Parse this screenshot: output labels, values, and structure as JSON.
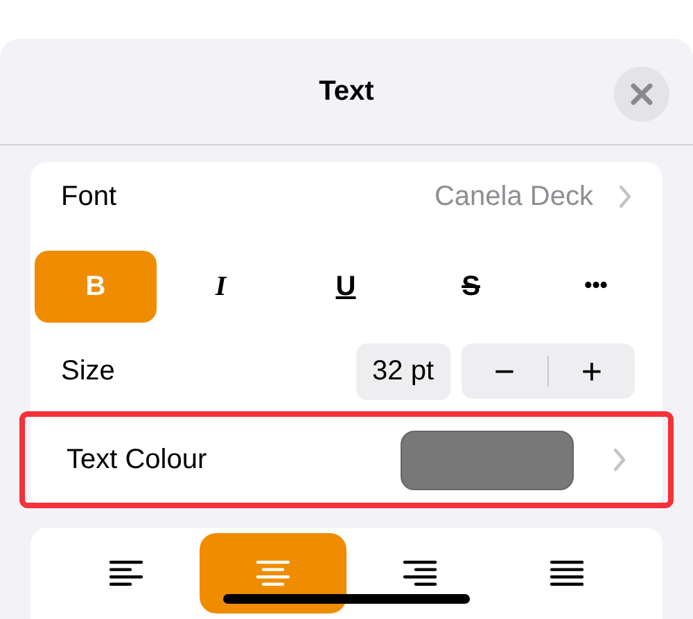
{
  "sheet": {
    "title": "Text"
  },
  "font": {
    "label": "Font",
    "value": "Canela Deck"
  },
  "styles": [
    {
      "label": "B",
      "kind": "bold",
      "selected": true
    },
    {
      "label": "I",
      "kind": "italic",
      "selected": false
    },
    {
      "label": "U",
      "kind": "underline",
      "selected": false
    },
    {
      "label": "S",
      "kind": "strike",
      "selected": false
    },
    {
      "label": "•••",
      "kind": "more",
      "selected": false
    }
  ],
  "size": {
    "label": "Size",
    "value": "32 pt",
    "decrement": "−",
    "increment": "+"
  },
  "text_colour": {
    "label": "Text Colour",
    "color": "#787878",
    "highlighted": true
  },
  "alignment": [
    {
      "kind": "left",
      "selected": false
    },
    {
      "kind": "center",
      "selected": true
    },
    {
      "kind": "right",
      "selected": false
    },
    {
      "kind": "justify",
      "selected": false
    }
  ]
}
